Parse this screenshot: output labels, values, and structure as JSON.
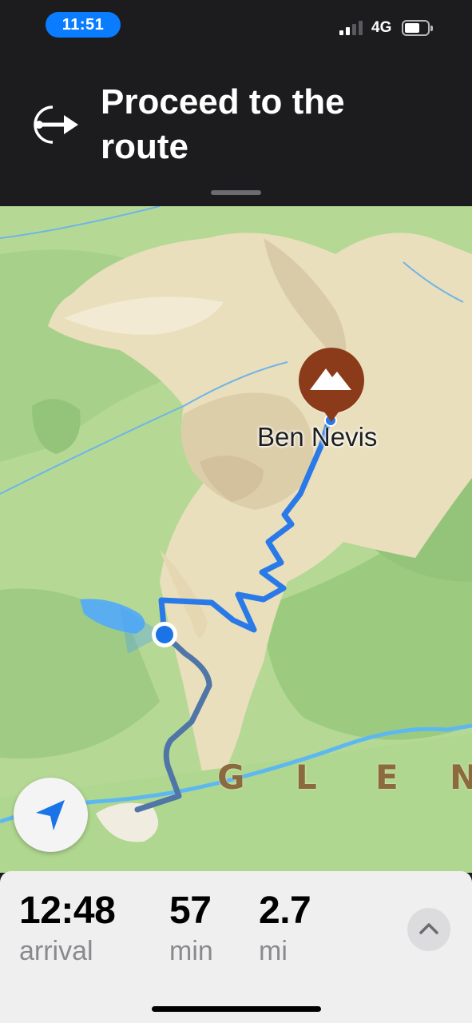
{
  "status_bar": {
    "time": "11:51",
    "network": "4G",
    "signal_bars_active": 2,
    "signal_bars_total": 4,
    "battery_level": 0.65
  },
  "banner": {
    "instruction": "Proceed to the route",
    "maneuver_icon": "proceed-to-route-icon"
  },
  "map": {
    "poi": {
      "name": "Ben Nevis",
      "icon": "mountain-icon",
      "marker_color": "#8b3a1a"
    },
    "area_label": [
      "G",
      "L",
      "E",
      "N"
    ],
    "route_color": "#2a79e8",
    "walked_route_color": "#4f76a6",
    "user_location_color": "#1a74e8"
  },
  "trip": {
    "arrival_value": "12:48",
    "arrival_label": "arrival",
    "duration_value": "57",
    "duration_label": "min",
    "distance_value": "2.7",
    "distance_label": "mi"
  },
  "controls": {
    "locate_icon": "location-arrow-icon",
    "expand_icon": "chevron-up-icon"
  }
}
